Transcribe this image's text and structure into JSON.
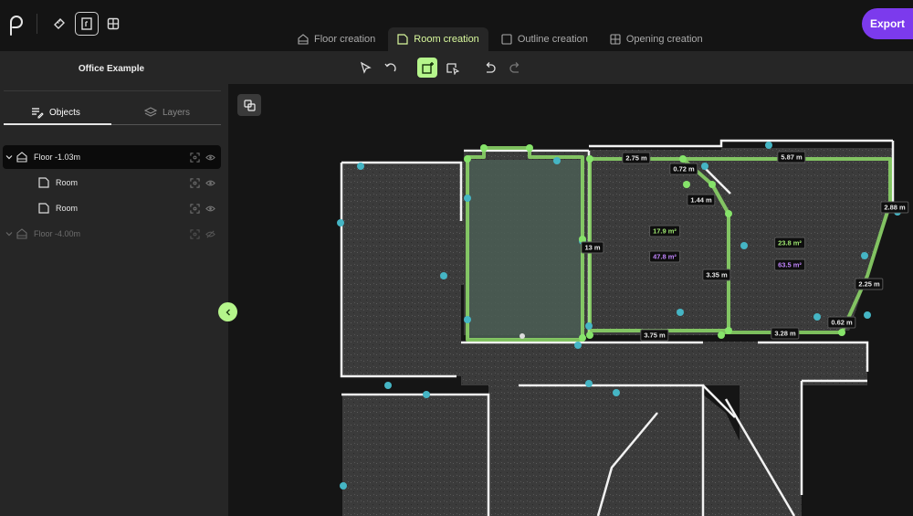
{
  "app": {
    "logo_icon": "app-logo-icon"
  },
  "header_tools": [
    {
      "name": "measure-tool",
      "icon": "ruler-icon"
    },
    {
      "name": "door-tool",
      "icon": "door-frame-icon",
      "active": true
    },
    {
      "name": "window-tool",
      "icon": "window-grid-icon"
    }
  ],
  "tabs": [
    {
      "label": "Floor creation",
      "icon": "floor-icon",
      "active": false
    },
    {
      "label": "Room creation",
      "icon": "room-icon",
      "active": true
    },
    {
      "label": "Outline creation",
      "icon": "outline-icon",
      "active": false
    },
    {
      "label": "Opening creation",
      "icon": "opening-icon",
      "active": false
    }
  ],
  "export_label": "Export",
  "sidebar": {
    "project_title": "Office Example",
    "tabs": {
      "objects": "Objects",
      "layers": "Layers"
    },
    "tree": [
      {
        "label": "Floor -1.03m",
        "level": 0,
        "expanded": true,
        "selected": true
      },
      {
        "label": "Room",
        "level": 1
      },
      {
        "label": "Room",
        "level": 1
      },
      {
        "label": "Floor -4.00m",
        "level": 0,
        "expanded": false,
        "hidden": true
      }
    ]
  },
  "toolbar": [
    {
      "name": "select-tool",
      "icon": "cursor-icon"
    },
    {
      "name": "rotate-tool",
      "icon": "rotate-icon"
    },
    {
      "name": "add-room-tool",
      "icon": "add-room-icon",
      "active": true
    },
    {
      "name": "edit-room-tool",
      "icon": "edit-room-icon"
    },
    {
      "name": "undo",
      "icon": "undo-icon"
    },
    {
      "name": "redo",
      "icon": "redo-icon"
    }
  ],
  "measurements": {
    "dims": [
      "2.75 m",
      "0.72 m",
      "5.87 m",
      "1.44 m",
      "2.88 m",
      "13 m",
      "3.35 m",
      "2.25 m",
      "0.62 m",
      "3.75 m",
      "3.28 m"
    ],
    "areas": [
      "17.9 m²",
      "47.8 m²",
      "23.8 m²",
      "63.5 m²"
    ]
  },
  "colors": {
    "accent_green": "#b5f58b",
    "room_outline": "#8fdc6a",
    "vertex_teal": "#45b5c4",
    "vertex_green": "#86e36a",
    "area_purple": "#c084fc",
    "export_purple": "#7c3aed"
  }
}
